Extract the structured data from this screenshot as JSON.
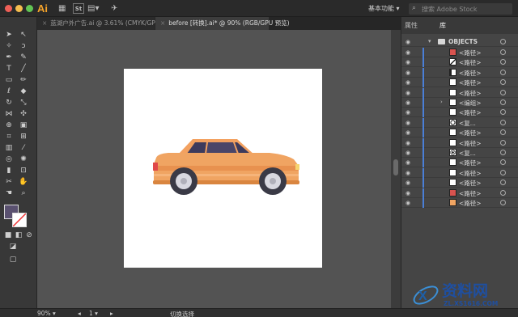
{
  "app": {
    "logo": "Ai",
    "workspace": "基本功能",
    "search_placeholder": "搜索 Adobe Stock"
  },
  "tabs": [
    {
      "label": "蓝湖户外广告.ai @ 3.61% (CMYK/GPU 预览)"
    },
    {
      "label": "before [转换].ai* @ 90% (RGB/GPU 预览)"
    }
  ],
  "panel": {
    "tab_properties": "属性",
    "tab_library": "库",
    "top_layer": "OBJECTS",
    "layers": [
      {
        "label": "<路径>",
        "thumb": "swatch-red"
      },
      {
        "label": "<路径>",
        "thumb": "shape-diag"
      },
      {
        "label": "<路径>",
        "thumb": "shape-corner"
      },
      {
        "label": "<路径>",
        "thumb": "blank"
      },
      {
        "label": "<路径>",
        "thumb": "blank"
      },
      {
        "label": "<编组>",
        "thumb": "blank",
        "expandable": true
      },
      {
        "label": "<路径>",
        "thumb": "blank"
      },
      {
        "label": "<复...",
        "thumb": "circle"
      },
      {
        "label": "<路径>",
        "thumb": "blank"
      },
      {
        "label": "<路径>",
        "thumb": "blank"
      },
      {
        "label": "<复...",
        "thumb": "circle-dot"
      },
      {
        "label": "<路径>",
        "thumb": "blank"
      },
      {
        "label": "<路径>",
        "thumb": "blank"
      },
      {
        "label": "<路径>",
        "thumb": "blank"
      },
      {
        "label": "<路径>",
        "thumb": "swatch-red"
      },
      {
        "label": "<路径>",
        "thumb": "swatch-orange"
      }
    ]
  },
  "status": {
    "zoom": "90%",
    "page": "1",
    "mode": "切换选择"
  },
  "watermark": {
    "brand": "资料网",
    "url": "ZL.XS1616.COM"
  },
  "colors": {
    "car_body": "#f0a462",
    "car_body_dark": "#e08748",
    "window": "#3d3a5c",
    "wheel": "#3a3a46",
    "hub": "#d8d8e0"
  }
}
